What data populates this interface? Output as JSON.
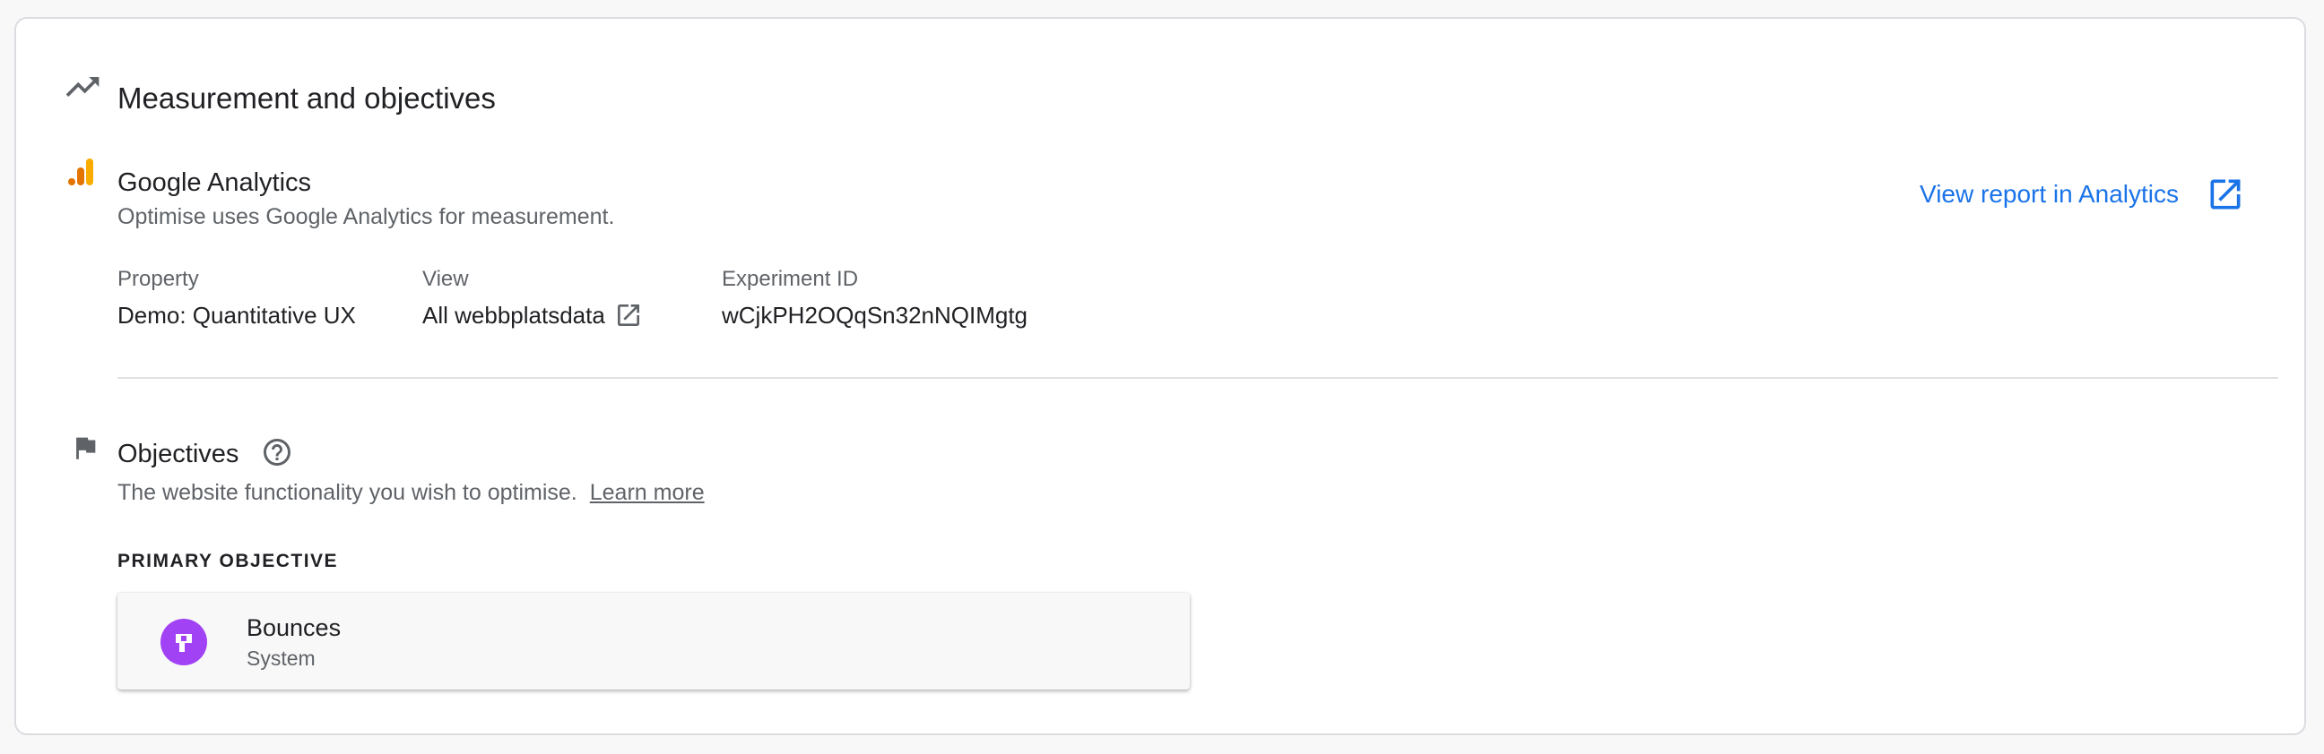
{
  "section": {
    "title": "Measurement and objectives",
    "icon": "trending-up-icon"
  },
  "analytics": {
    "title": "Google Analytics",
    "description": "Optimise uses Google Analytics for measurement.",
    "view_report_label": "View report in Analytics",
    "view_report_icon": "open-in-new-icon",
    "icon": "analytics-logo-icon",
    "brand_colors": [
      "#e37400",
      "#f9ab00"
    ],
    "details": [
      {
        "label": "Property",
        "value": "Demo: Quantitative UX"
      },
      {
        "label": "View",
        "value": "All webbplatsdata"
      },
      {
        "label": "Experiment ID",
        "value": "wCjkPH2OQqSn32nNQIMgtg"
      }
    ]
  },
  "objectives": {
    "title": "Objectives",
    "icon": "flag-icon",
    "help_icon": "help-circle-icon",
    "description": "The website functionality you wish to optimise.",
    "learn_more": "Learn more",
    "primary_heading": "PRIMARY OBJECTIVE",
    "primary": {
      "name": "Bounces",
      "type": "System",
      "icon": "bounce-icon",
      "icon_color": "#a142f4"
    }
  },
  "colors": {
    "link": "#1a73e8",
    "text": "#202124",
    "secondary_text": "#5f6368"
  }
}
